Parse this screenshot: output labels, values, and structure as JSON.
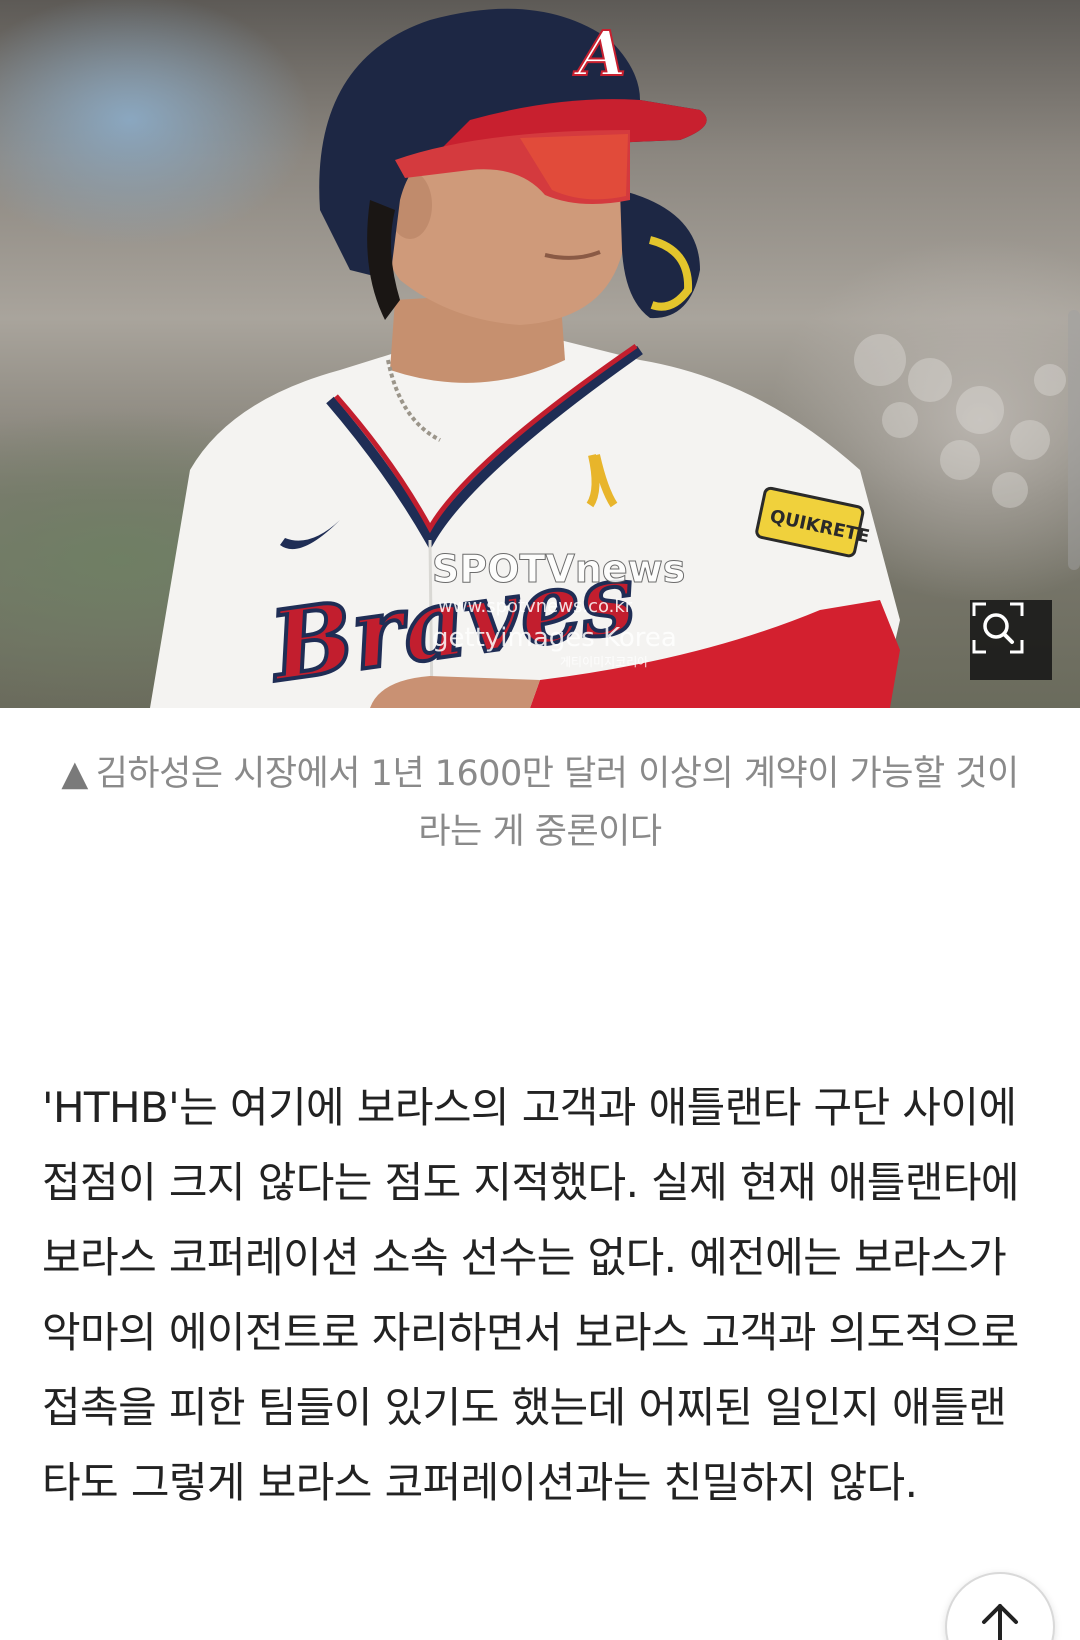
{
  "photo": {
    "watermark_brand": "SPOTVnews",
    "watermark_url": "www.spotvnews.co.kr",
    "watermark_credit": "gettyimages Korea",
    "watermark_credit_ko": "게티이미지코리아",
    "jersey_text": "Braves",
    "patch_text": "QUIKRETE",
    "zoom_icon": "zoom-magnifier-icon"
  },
  "caption": {
    "marker": "▲",
    "text": "김하성은 시장에서 1년 1600만 달러 이상의 계약이 가능할 것이라는 게 중론이다"
  },
  "article": {
    "paragraph": "'HTHB'는 여기에 보라스의 고객과 애틀랜타 구단 사이에 접점이 크지 않다는 점도 지적했다. 실제 현재 애틀랜타에 보라스 코퍼레이션 소속 선수는 없다. 예전에는 보라스가 악마의 에이전트로 자리하면서 보라스 고객과 의도적으로 접촉을 피한 팀들이 있기도 했는데 어찌된 일인지 애틀랜타도 그렇게 보라스 코퍼레이션과는 친밀하지 않다."
  },
  "controls": {
    "scroll_top_icon": "arrow-up-icon"
  }
}
